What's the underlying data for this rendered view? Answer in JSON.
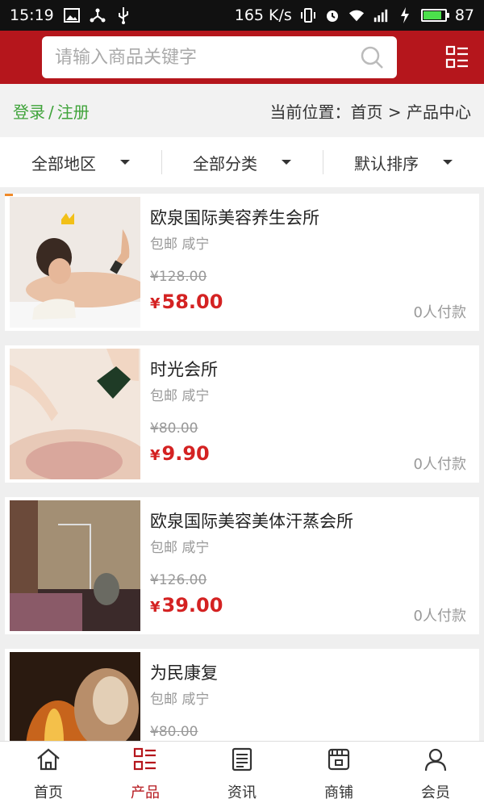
{
  "status_bar": {
    "time": "15:19",
    "net_speed": "165 K/s",
    "battery": "87",
    "battery_level": 0.87
  },
  "search": {
    "placeholder": "请输入商品关键字"
  },
  "breadcrumb": {
    "login": "登录",
    "separator": "/",
    "register": "注册",
    "location": "当前位置：首页 > 产品中心"
  },
  "filters": [
    {
      "label": "全部地区"
    },
    {
      "label": "全部分类"
    },
    {
      "label": "默认排序"
    }
  ],
  "products": [
    {
      "title": "欧泉国际美容养生会所",
      "shipping": "包邮 咸宁",
      "original_price": "¥128.00",
      "currency": "¥",
      "price": "58.00",
      "paid": "0人付款"
    },
    {
      "title": "时光会所",
      "shipping": "包邮 咸宁",
      "original_price": "¥80.00",
      "currency": "¥",
      "price": "9.90",
      "paid": "0人付款"
    },
    {
      "title": "欧泉国际美容美体汗蒸会所",
      "shipping": "包邮 咸宁",
      "original_price": "¥126.00",
      "currency": "¥",
      "price": "39.00",
      "paid": "0人付款"
    },
    {
      "title": "为民康复",
      "shipping": "包邮 咸宁",
      "original_price": "¥80.00",
      "currency": "¥",
      "price": "",
      "paid": ""
    }
  ],
  "nav": [
    {
      "label": "首页",
      "icon": "home-icon"
    },
    {
      "label": "产品",
      "icon": "product-list-icon"
    },
    {
      "label": "资讯",
      "icon": "news-icon"
    },
    {
      "label": "商铺",
      "icon": "shop-icon"
    },
    {
      "label": "会员",
      "icon": "member-icon"
    }
  ],
  "colors": {
    "brand_red": "#b5161c",
    "price_red": "#d42222",
    "login_green": "#3fa33a"
  }
}
